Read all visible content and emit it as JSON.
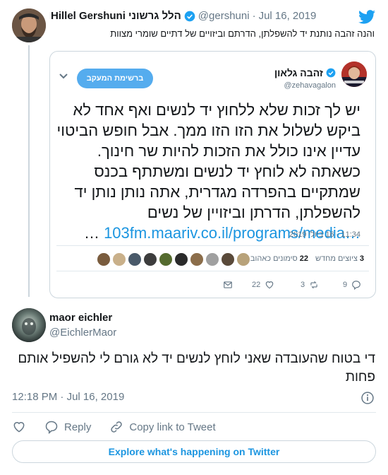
{
  "parent_tweet": {
    "author_name": "Hillel Gershuni הלל גרשוני",
    "handle": "@gershuni",
    "separator": "·",
    "date": "Jul 16, 2019",
    "text": "והנה זהבה נותנת יד להשפלתן, הדרתם וביזויים של דתיים שומרי מצוות"
  },
  "quoted_tweet": {
    "author_name": "זהבה גלאון",
    "handle": "@zehavagalon",
    "follow_label": "ברשימת המעקב",
    "body_lines": [
      "יש לך זכות שלא ללחוץ יד לנשים ואף אחד לא",
      "ביקש לשלול את הזו הזו ממך. אבל חופש הביטוי",
      "עדיין אינו כולל את הזכות להיות שר חינוך.",
      "כשאתה לא לוחץ יד לנשים ומשתתף בכנס",
      "שמתקיים בהפרדה מגדרית, אתה נותן נותן יד",
      "להשפלתן, הדרתן וביזויין של נשים"
    ],
    "link_text": "103fm.maariv.co.il/programs/media…",
    "link_ellipsis": "…",
    "timestamp": "11:34 - 16 ביולי 2019",
    "retweets_count": "3",
    "retweets_label": "ציוצים מחדש",
    "likes_count": "22",
    "likes_label": "סימונים כאהוב",
    "actions": {
      "reply_count": "9",
      "retweet_count": "3",
      "like_count": "22"
    },
    "face_colors": [
      "#7a5c3e",
      "#c9b08a",
      "#4a5a6a",
      "#3d3d3d",
      "#556b2f",
      "#2b2b2b",
      "#8b6d4a",
      "#a0a0a0",
      "#5a4a3a",
      "#b8a27a"
    ]
  },
  "main_tweet": {
    "author_name": "maor eichler",
    "handle": "@EichlerMaor",
    "text": "די בטוח שהעובדה שאני לוחץ לנשים יד לא גורם לי להשפיל אותם פחות",
    "time": "12:18 PM",
    "separator": "·",
    "date": "Jul 16, 2019",
    "reply_label": "Reply",
    "copy_link_label": "Copy link to Tweet",
    "explore_label": "Explore what's happening on Twitter"
  },
  "colors": {
    "twitter_blue": "#1da1f2",
    "link_blue": "#1b95e0",
    "follow_blue": "#55acee",
    "muted": "#657786",
    "border": "#ccd6dd"
  }
}
